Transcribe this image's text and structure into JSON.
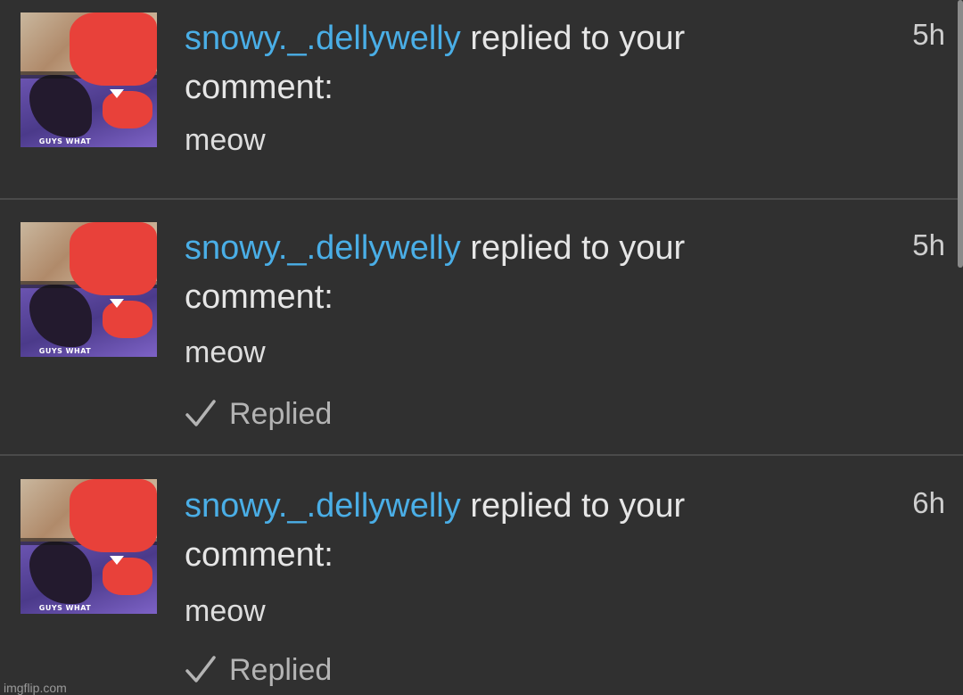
{
  "notifications": [
    {
      "username": "snowy._.dellywelly",
      "action_line1": " replied to your",
      "action_line2": "comment:",
      "time": "5h",
      "message": "meow",
      "status": "",
      "avatar_caption": "GUYS WHAT"
    },
    {
      "username": "snowy._.dellywelly",
      "action_line1": " replied to your",
      "action_line2": "comment:",
      "time": "5h",
      "message": "meow",
      "status": "Replied",
      "avatar_caption": "GUYS WHAT"
    },
    {
      "username": "snowy._.dellywelly",
      "action_line1": " replied to your",
      "action_line2": "comment:",
      "time": "6h",
      "message": "meow",
      "status": "Replied",
      "avatar_caption": "GUYS WHAT"
    }
  ],
  "watermark": "imgflip.com",
  "colors": {
    "background": "#303030",
    "divider": "#4a4a4a",
    "username": "#4aaee6",
    "text": "#e6e6e6",
    "muted": "#b4b4b4"
  },
  "icons": {
    "replied": "check-icon"
  }
}
